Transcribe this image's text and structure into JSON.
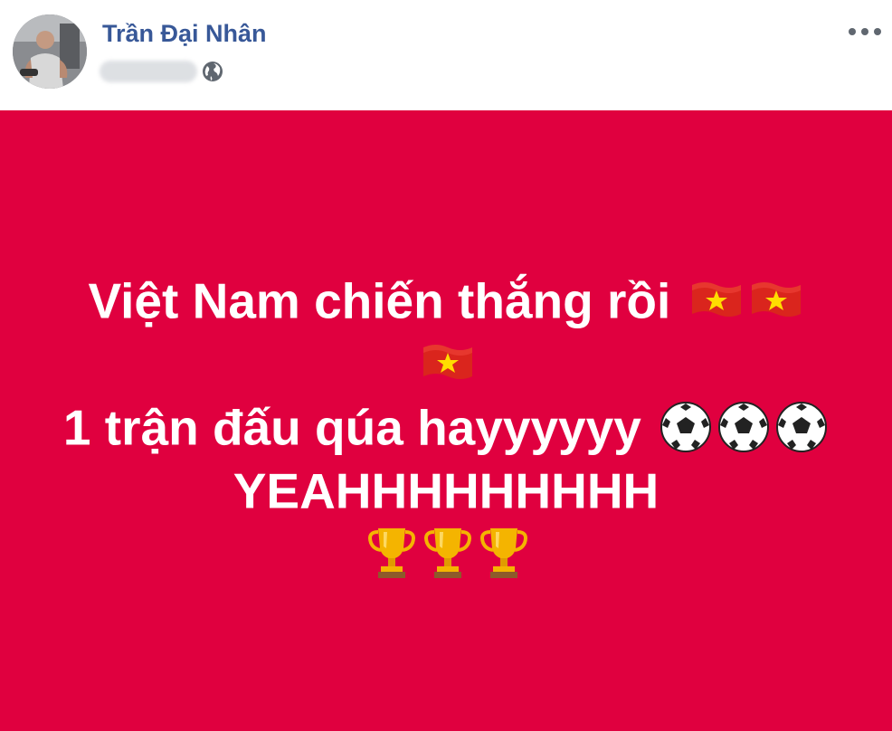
{
  "post": {
    "author": {
      "name": "Trần Đại Nhân",
      "avatar_icon": "profile-photo",
      "privacy_icon": "globe-icon"
    },
    "more_icon": "more-options-icon",
    "background_color": "#e0003f",
    "text_color": "#ffffff",
    "lines": {
      "line1": "Việt Nam chiến thắng rồi",
      "line3": "1 trận đấu qúa hayyyyyy",
      "line4": "YEAHHHHHHHHH"
    },
    "emoji": {
      "flag": "vietnam-flag-icon",
      "ball": "soccer-ball-icon",
      "trophy": "trophy-icon",
      "flag_count": 3,
      "ball_count": 3,
      "trophy_count": 3
    }
  },
  "colors": {
    "name_link": "#385898",
    "post_bg": "#e0003f",
    "flag_red": "#da251d",
    "flag_star": "#ffdd00",
    "trophy_gold": "#f4b400"
  }
}
